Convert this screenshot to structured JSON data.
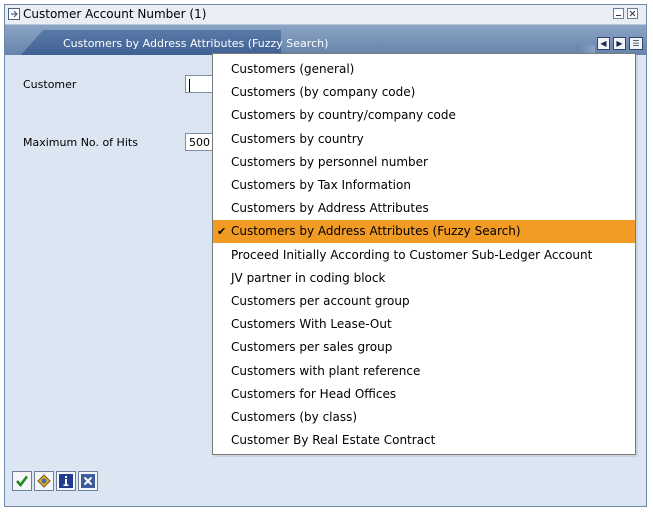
{
  "window": {
    "title": "Customer Account Number (1)"
  },
  "tab": {
    "label": "Customers by Address Attributes (Fuzzy Search)"
  },
  "form": {
    "customer_label": "Customer",
    "customer_value": "",
    "max_hits_label": "Maximum No. of Hits",
    "max_hits_value": "500"
  },
  "dropdown": {
    "selected_index": 7,
    "items": [
      "Customers (general)",
      "Customers (by company code)",
      "Customers by country/company code",
      "Customers by country",
      "Customers by personnel number",
      "Customers by Tax Information",
      "Customers by Address Attributes",
      "Customers by Address Attributes (Fuzzy Search)",
      "Proceed Initially According to Customer Sub-Ledger Account",
      "JV partner in coding block",
      "Customers per account group",
      "Customers With Lease-Out",
      "Customers per sales group",
      "Customers with plant reference",
      "Customers for Head Offices",
      "Customers (by class)",
      "Customer By Real Estate Contract"
    ]
  },
  "toolbar": {
    "buttons": [
      "check-icon",
      "multiple-selection-icon",
      "info-icon",
      "cancel-icon"
    ]
  },
  "colors": {
    "selection": "#f19a24",
    "tab": "#3f6193",
    "window_bg": "#dbe6f2"
  }
}
